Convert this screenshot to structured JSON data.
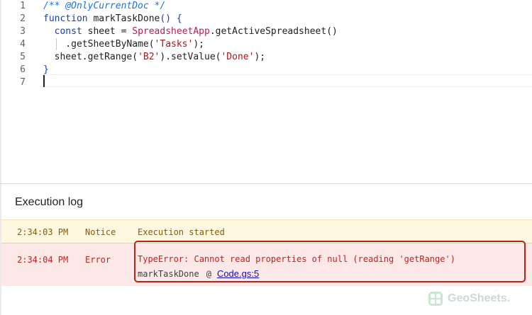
{
  "editor": {
    "lines": [
      {
        "num": "1",
        "tokens": [
          {
            "t": "/** @OnlyCurrentDoc */",
            "c": "comment"
          }
        ]
      },
      {
        "num": "2",
        "tokens": [
          {
            "t": "function",
            "c": "kw"
          },
          {
            "t": " markTaskDone",
            "c": ""
          },
          {
            "t": "() {",
            "c": "kw"
          }
        ]
      },
      {
        "num": "3",
        "tokens": [
          {
            "t": "  const",
            "c": "kw"
          },
          {
            "t": " sheet = ",
            "c": ""
          },
          {
            "t": "SpreadsheetApp",
            "c": "cls"
          },
          {
            "t": ".getActiveSpreadsheet",
            "c": ""
          },
          {
            "t": "()",
            "c": "punct"
          }
        ]
      },
      {
        "num": "4",
        "tokens": [
          {
            "t": "    .getSheetByName(",
            "c": ""
          },
          {
            "t": "'Tasks'",
            "c": "str"
          },
          {
            "t": ");",
            "c": ""
          }
        ]
      },
      {
        "num": "5",
        "tokens": [
          {
            "t": "  sheet.getRange(",
            "c": ""
          },
          {
            "t": "'B2'",
            "c": "str"
          },
          {
            "t": ").setValue(",
            "c": ""
          },
          {
            "t": "'Done'",
            "c": "str"
          },
          {
            "t": ");",
            "c": ""
          }
        ]
      },
      {
        "num": "6",
        "tokens": [
          {
            "t": "}",
            "c": "kw"
          }
        ]
      },
      {
        "num": "7",
        "tokens": []
      }
    ]
  },
  "log": {
    "title": "Execution log",
    "entries": [
      {
        "time": "2:34:03 PM",
        "level": "Notice",
        "message": "Execution started"
      },
      {
        "time": "2:34:04 PM",
        "level": "Error",
        "message": "TypeError: Cannot read properties of null (reading 'getRange')",
        "trace_function": "markTaskDone",
        "trace_at": "@",
        "trace_link": "Code.gs:5"
      }
    ]
  },
  "watermark": {
    "text": "GeoSheets."
  },
  "colors": {
    "notice_bg": "#fef7e0",
    "error_bg": "#fce8e6",
    "error_text": "#c5221f",
    "highlight_border": "#b3261e",
    "keyword": "#1a3fa8",
    "class": "#c2185b",
    "string": "#b31412",
    "comment": "#1a73e8"
  }
}
